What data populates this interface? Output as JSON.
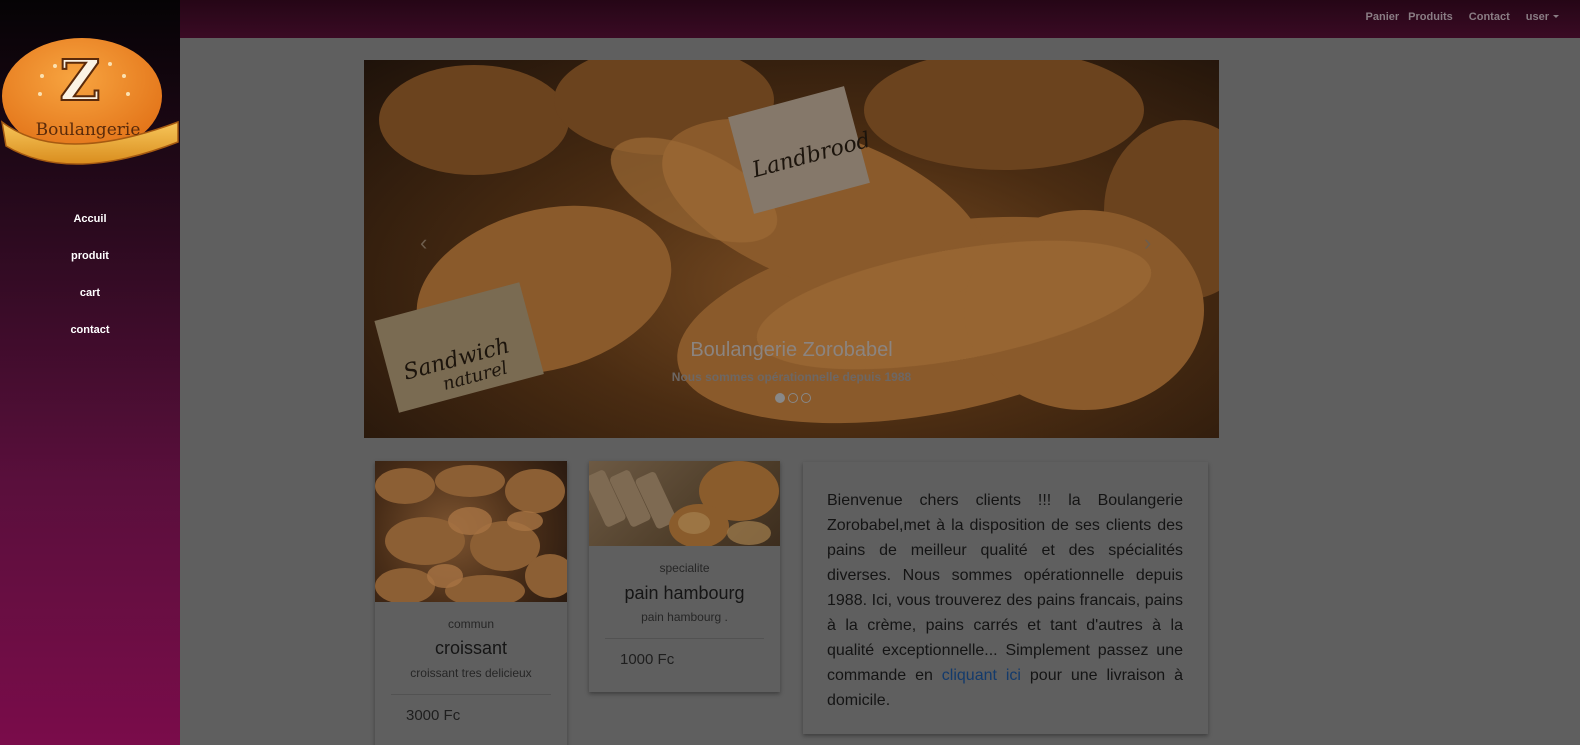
{
  "brand": {
    "logo_letter": "Z",
    "logo_text": "Boulangerie"
  },
  "sidebar": {
    "items": [
      {
        "label": "Accuil"
      },
      {
        "label": "produit"
      },
      {
        "label": "cart"
      },
      {
        "label": "contact"
      }
    ]
  },
  "topnav": {
    "items": [
      {
        "label": "Panier"
      },
      {
        "label": "Produits"
      },
      {
        "label": "Contact"
      },
      {
        "label": "user"
      }
    ]
  },
  "carousel": {
    "title": "Boulangerie Zorobabel",
    "subtitle": "Nous sommes opérationnelle depuis 1988",
    "sign_left_1": "Sandwich",
    "sign_left_2": "naturel",
    "sign_right": "Landbrood",
    "prev_icon": "‹",
    "next_icon": "›",
    "slide_count": 3,
    "active_slide": 1
  },
  "products": [
    {
      "category": "commun",
      "name": "croissant",
      "description": "croissant tres delicieux",
      "price": "3000 Fc"
    },
    {
      "category": "specialite",
      "name": "pain hambourg",
      "description": "pain hambourg .",
      "price": "1000 Fc"
    }
  ],
  "welcome": {
    "text_before": "Bienvenue chers clients !!! la Boulangerie Zorobabel,met à la disposition de ses clients des pains de meilleur qualité et des spécialités diverses. Nous sommes opérationnelle depuis 1988. Ici, vous trouverez des pains francais, pains à la crème, pains carrés et tant d'autres à la qualité exceptionnelle... Simplement passez une commande en ",
    "link_text": "cliquant ici",
    "text_after": " pour une livraison à domicile."
  },
  "colors": {
    "link": "#133a6b",
    "sidebar_bottom": "#7a0c4a",
    "topbar": "#3a0a24"
  }
}
